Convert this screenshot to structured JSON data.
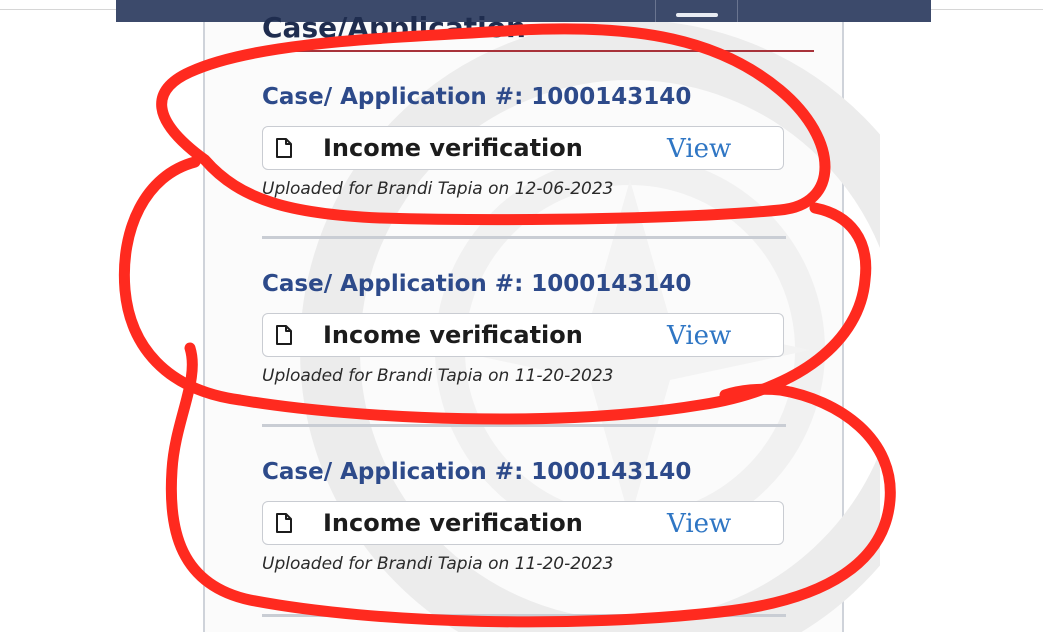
{
  "page": {
    "cut_heading": "Case/Application"
  },
  "cases": [
    {
      "title": "Case/ Application #: 1000143140",
      "document_label": "Income verification",
      "view_label": "View",
      "uploaded_text": "Uploaded for Brandi Tapia on 12-06-2023",
      "icon": "document-icon"
    },
    {
      "title": "Case/ Application #: 1000143140",
      "document_label": "Income verification",
      "view_label": "View",
      "uploaded_text": "Uploaded for Brandi Tapia on 11-20-2023",
      "icon": "document-icon"
    },
    {
      "title": "Case/ Application #: 1000143140",
      "document_label": "Income verification",
      "view_label": "View",
      "uploaded_text": "Uploaded for Brandi Tapia on 11-20-2023",
      "icon": "document-icon"
    }
  ],
  "colors": {
    "topbar": "#3c4a6b",
    "case_title": "#2d4a8a",
    "view_link": "#2f76c4",
    "heading_rule": "#a8323a",
    "annotation": "#ff2a1f"
  }
}
